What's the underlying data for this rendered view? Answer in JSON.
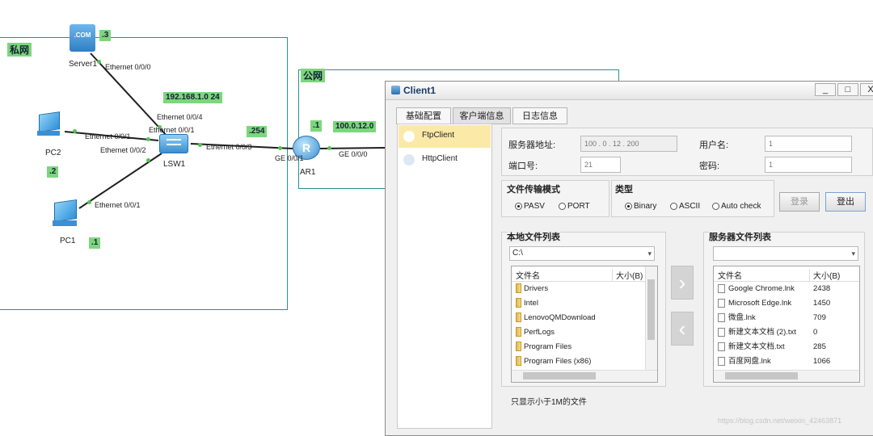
{
  "topology": {
    "zones": {
      "private": "私网",
      "public": "公网"
    },
    "devices": {
      "server1": {
        "name": "Server1",
        "addr": ".3",
        "icon_text": ".COM"
      },
      "pc2": {
        "name": "PC2",
        "addr": ".2"
      },
      "pc1": {
        "name": "PC1",
        "addr": ".1"
      },
      "lsw1": {
        "name": "LSW1"
      },
      "ar1": {
        "name": "AR1",
        "addr": ".254",
        "addr_public": ".1"
      }
    },
    "network_labels": {
      "private_net": "192.168.1.0 24",
      "public_net": "100.0.12.0"
    },
    "ports": {
      "server1_eth": "Ethernet 0/0/0",
      "lsw_eth4": "Ethernet 0/0/4",
      "pc2_eth": "Ethernet 0/0/1",
      "lsw_eth1": "Ethernet 0/0/1",
      "lsw_eth2": "Ethernet 0/0/2",
      "pc1_eth": "Ethernet 0/0/1",
      "lsw_eth3": "Ethernet 0/0/3",
      "ar_ge1": "GE 0/0/1",
      "ar_ge0": "GE 0/0/0"
    }
  },
  "window": {
    "title": "Client1",
    "controls": {
      "minimize": "_",
      "maximize": "□",
      "close": "X"
    },
    "tabs": [
      "基础配置",
      "客户端信息",
      "日志信息"
    ],
    "active_tab": 1,
    "sidebar": [
      "FtpClient",
      "HttpClient"
    ],
    "form": {
      "server_addr_label": "服务器地址:",
      "server_addr": "100 . 0 . 12 . 200",
      "username_label": "用户名:",
      "username": "1",
      "port_label": "端口号:",
      "port": "21",
      "password_label": "密码:",
      "password": "1"
    },
    "transfer_mode": {
      "title": "文件传输模式",
      "options": [
        "PASV",
        "PORT"
      ],
      "selected": "PASV"
    },
    "type": {
      "title": "类型",
      "options": [
        "Binary",
        "ASCII",
        "Auto check"
      ],
      "selected": "Binary"
    },
    "buttons": {
      "login": "登录",
      "logout": "登出"
    },
    "local": {
      "title": "本地文件列表",
      "path": "C:\\",
      "headers": [
        "文件名",
        "大小(B)"
      ],
      "files": [
        "Drivers",
        "Intel",
        "LenovoQMDownload",
        "PerfLogs",
        "Program Files",
        "Program Files (x86)"
      ]
    },
    "server": {
      "title": "服务器文件列表",
      "path": "",
      "headers": [
        "文件名",
        "大小(B)"
      ],
      "files": [
        {
          "name": "Google Chrome.lnk",
          "size": "2438"
        },
        {
          "name": "Microsoft Edge.lnk",
          "size": "1450"
        },
        {
          "name": "微盘.lnk",
          "size": "709"
        },
        {
          "name": "新建文本文档 (2).txt",
          "size": "0"
        },
        {
          "name": "新建文本文档.txt",
          "size": "285"
        },
        {
          "name": "百度网盘.lnk",
          "size": "1066"
        }
      ]
    },
    "transfer_arrows": {
      "upload": "›",
      "download": "‹"
    },
    "footer_note": "只显示小于1M的文件"
  },
  "watermark": "https://blog.csdn.net/weixin_42463871",
  "colors": {
    "label_bg": "#7dd67d",
    "zone_border": "#2b8f8f",
    "link": "#1f1f1f",
    "port_dot": "#55c255",
    "active_sidebar": "#fbe9a8"
  }
}
